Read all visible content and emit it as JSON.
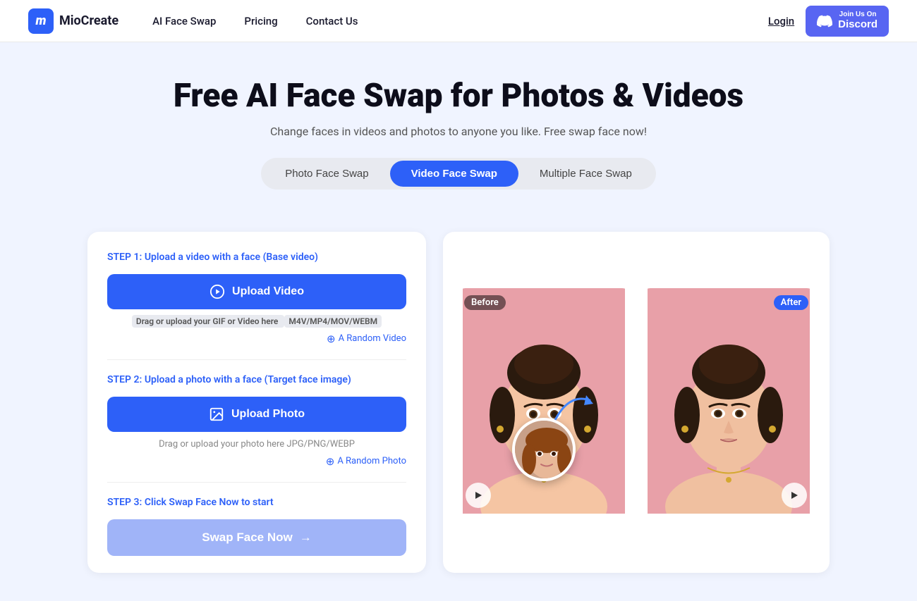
{
  "header": {
    "logo_letter": "m",
    "logo_name": "MioCreate",
    "nav": [
      {
        "label": "AI Face Swap",
        "href": "#"
      },
      {
        "label": "Pricing",
        "href": "#"
      },
      {
        "label": "Contact Us",
        "href": "#"
      }
    ],
    "login_label": "Login",
    "discord_top": "Join Us On",
    "discord_label": "Discord"
  },
  "hero": {
    "title": "Free AI Face Swap for Photos & Videos",
    "subtitle": "Change faces in videos and photos to anyone you like. Free swap face now!"
  },
  "tabs": [
    {
      "label": "Photo Face Swap",
      "active": false
    },
    {
      "label": "Video Face Swap",
      "active": true
    },
    {
      "label": "Multiple Face Swap",
      "active": false
    }
  ],
  "left_panel": {
    "step1_prefix": "STEP 1:",
    "step1_text": " Upload a video with a face (Base video)",
    "upload_video_label": "Upload Video",
    "drag_text_prefix": "Drag or upload your GIF or Video here ",
    "drag_formats": "M4V/MP4/MOV/WEBM",
    "random_video_label": "A Random Video",
    "step2_prefix": "STEP 2:",
    "step2_text": " Upload a photo with a face (Target face image)",
    "upload_photo_label": "Upload Photo",
    "drag_photo_text": "Drag or upload your photo here JPG/PNG/WEBP",
    "random_photo_label": "A Random Photo",
    "step3_prefix": "STEP 3:",
    "step3_text": " Click Swap Face Now to start",
    "swap_btn_label": "Swap Face Now",
    "swap_btn_arrow": "→"
  },
  "preview": {
    "before_label": "Before",
    "after_label": "After"
  },
  "colors": {
    "primary": "#2d60f8",
    "discord": "#5865f2",
    "tab_bg": "#e8eaf0"
  }
}
